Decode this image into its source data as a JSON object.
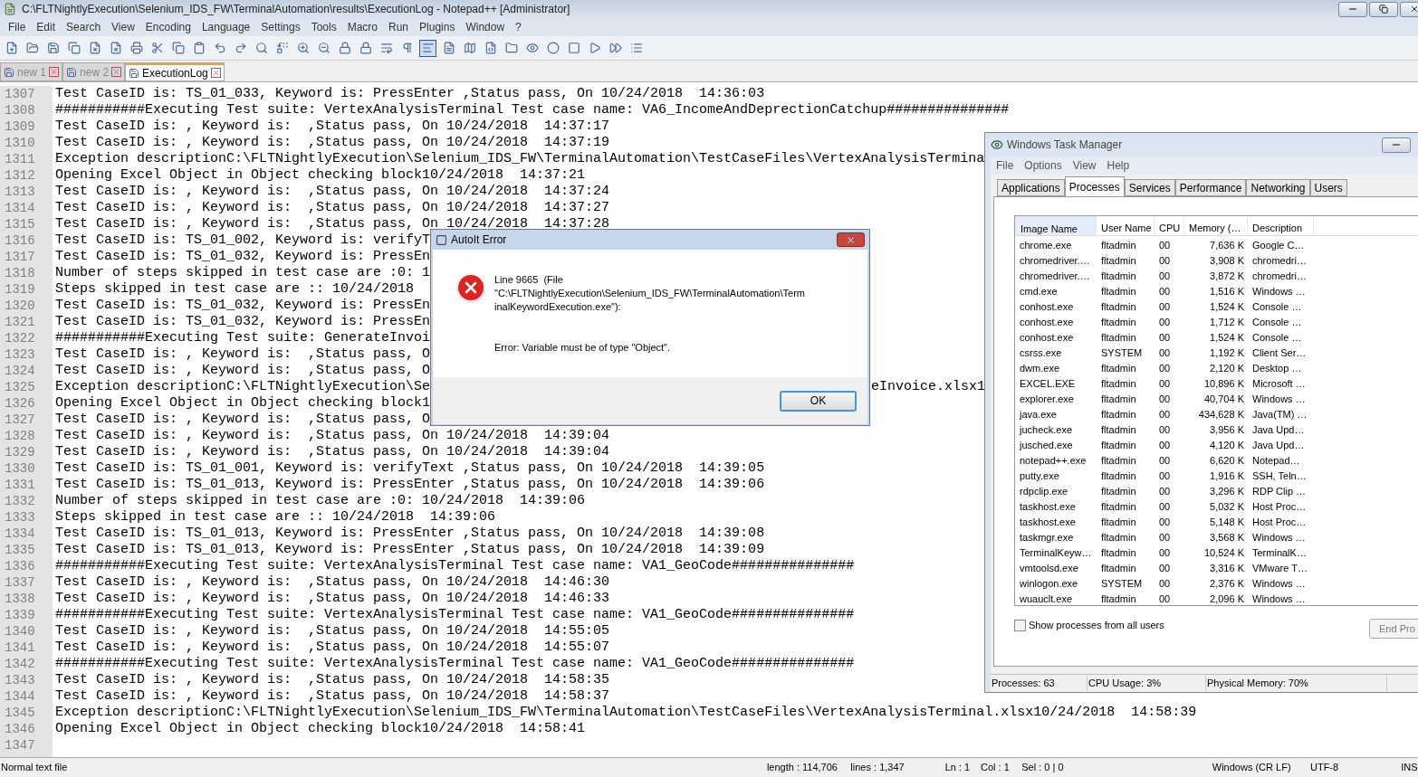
{
  "window": {
    "title": "C:\\FLTNightlyExecution\\Selenium_IDS_FW\\TerminalAutomation\\results\\ExecutionLog - Notepad++ [Administrator]"
  },
  "menu": [
    "File",
    "Edit",
    "Search",
    "View",
    "Encoding",
    "Language",
    "Settings",
    "Tools",
    "Macro",
    "Run",
    "Plugins",
    "Window",
    "?"
  ],
  "tabs": [
    {
      "label": "new 1",
      "selected": false
    },
    {
      "label": "new 2",
      "selected": false
    },
    {
      "label": "ExecutionLog",
      "selected": true
    }
  ],
  "editor": {
    "lines": [
      {
        "no": "1307",
        "text": "Test CaseID is: TS_01_033, Keyword is: PressEnter ,Status pass, On 10/24/2018  14:36:03"
      },
      {
        "no": "1308",
        "text": "###########Executing Test suite: VertexAnalysisTerminal Test case name: VA6_IncomeAndDeprectionCatchup###############"
      },
      {
        "no": "1309",
        "text": "Test CaseID is: , Keyword is:  ,Status pass, On 10/24/2018  14:37:17"
      },
      {
        "no": "1310",
        "text": "Test CaseID is: , Keyword is:  ,Status pass, On 10/24/2018  14:37:19"
      },
      {
        "no": "1311",
        "text": "Exception descriptionC:\\FLTNightlyExecution\\Selenium_IDS_FW\\TerminalAutomation\\TestCaseFiles\\VertexAnalysisTermina"
      },
      {
        "no": "1312",
        "text": "Opening Excel Object in Object checking block10/24/2018  14:37:21"
      },
      {
        "no": "1313",
        "text": "Test CaseID is: , Keyword is:  ,Status pass, On 10/24/2018  14:37:24"
      },
      {
        "no": "1314",
        "text": "Test CaseID is: , Keyword is:  ,Status pass, On 10/24/2018  14:37:27"
      },
      {
        "no": "1315",
        "text": "Test CaseID is: , Keyword is:  ,Status pass, On 10/24/2018  14:37:28"
      },
      {
        "no": "1316",
        "text": "Test CaseID is: TS_01_002, Keyword is: verifyT"
      },
      {
        "no": "1317",
        "text": "Test CaseID is: TS_01_032, Keyword is: PressEn"
      },
      {
        "no": "1318",
        "text": "Number of steps skipped in test case are :0: 1"
      },
      {
        "no": "1319",
        "text": "Steps skipped in test case are :: 10/24/2018"
      },
      {
        "no": "1320",
        "text": "Test CaseID is: TS_01_032, Keyword is: PressEn"
      },
      {
        "no": "1321",
        "text": "Test CaseID is: TS_01_032, Keyword is: PressEn"
      },
      {
        "no": "1322",
        "text": "###########Executing Test suite: GenerateInvoi"
      },
      {
        "no": "1323",
        "text": "Test CaseID is: , Keyword is:  ,Status pass, O"
      },
      {
        "no": "1324",
        "text": "Test CaseID is: , Keyword is:  ,Status pass, O"
      },
      {
        "no": "1325",
        "text": "Exception descriptionC:\\FLTNightlyExecution\\Se",
        "text_right": "eInvoice.xlsx1"
      },
      {
        "no": "1326",
        "text": "Opening Excel Object in Object checking block1"
      },
      {
        "no": "1327",
        "text": "Test CaseID is: , Keyword is:  ,Status pass, O"
      },
      {
        "no": "1328",
        "text": "Test CaseID is: , Keyword is:  ,Status pass, On 10/24/2018  14:39:04"
      },
      {
        "no": "1329",
        "text": "Test CaseID is: , Keyword is:  ,Status pass, On 10/24/2018  14:39:04"
      },
      {
        "no": "1330",
        "text": "Test CaseID is: TS_01_001, Keyword is: verifyText ,Status pass, On 10/24/2018  14:39:05"
      },
      {
        "no": "1331",
        "text": "Test CaseID is: TS_01_013, Keyword is: PressEnter ,Status pass, On 10/24/2018  14:39:06"
      },
      {
        "no": "1332",
        "text": "Number of steps skipped in test case are :0: 10/24/2018  14:39:06"
      },
      {
        "no": "1333",
        "text": "Steps skipped in test case are :: 10/24/2018  14:39:06"
      },
      {
        "no": "1334",
        "text": "Test CaseID is: TS_01_013, Keyword is: PressEnter ,Status pass, On 10/24/2018  14:39:08"
      },
      {
        "no": "1335",
        "text": "Test CaseID is: TS_01_013, Keyword is: PressEnter ,Status pass, On 10/24/2018  14:39:09"
      },
      {
        "no": "1336",
        "text": "###########Executing Test suite: VertexAnalysisTerminal Test case name: VA1_GeoCode###############"
      },
      {
        "no": "1337",
        "text": "Test CaseID is: , Keyword is:  ,Status pass, On 10/24/2018  14:46:30"
      },
      {
        "no": "1338",
        "text": "Test CaseID is: , Keyword is:  ,Status pass, On 10/24/2018  14:46:33"
      },
      {
        "no": "1339",
        "text": "###########Executing Test suite: VertexAnalysisTerminal Test case name: VA1_GeoCode###############"
      },
      {
        "no": "1340",
        "text": "Test CaseID is: , Keyword is:  ,Status pass, On 10/24/2018  14:55:05"
      },
      {
        "no": "1341",
        "text": "Test CaseID is: , Keyword is:  ,Status pass, On 10/24/2018  14:55:07"
      },
      {
        "no": "1342",
        "text": "###########Executing Test suite: VertexAnalysisTerminal Test case name: VA1_GeoCode###############"
      },
      {
        "no": "1343",
        "text": "Test CaseID is: , Keyword is:  ,Status pass, On 10/24/2018  14:58:35"
      },
      {
        "no": "1344",
        "text": "Test CaseID is: , Keyword is:  ,Status pass, On 10/24/2018  14:58:37"
      },
      {
        "no": "1345",
        "text": "Exception descriptionC:\\FLTNightlyExecution\\Selenium_IDS_FW\\TerminalAutomation\\TestCaseFiles\\VertexAnalysisTerminal.xlsx10/24/2018  14:58:39"
      },
      {
        "no": "1346",
        "text": "Opening Excel Object in Object checking block10/24/2018  14:58:41"
      },
      {
        "no": "1347"
      }
    ]
  },
  "status_bar": [
    "Normal text file",
    "length : 114,706",
    "lines : 1,347",
    "Ln : 1",
    "Col : 1",
    "Sel : 0 | 0",
    "Windows (CR LF)",
    "UTF-8",
    "INS"
  ],
  "task_manager": {
    "title": "Windows Task Manager",
    "menu": [
      "File",
      "Options",
      "View",
      "Help"
    ],
    "tabs": [
      {
        "label": "Applications",
        "selected": false
      },
      {
        "label": "Processes",
        "selected": true
      },
      {
        "label": "Services",
        "selected": false
      },
      {
        "label": "Performance",
        "selected": false
      },
      {
        "label": "Networking",
        "selected": false
      },
      {
        "label": "Users",
        "selected": false
      }
    ],
    "columns": [
      "Image Name",
      "User Name",
      "CPU",
      "Memory (…",
      "Description"
    ],
    "rows": [
      [
        "chrome.exe",
        "fltadmin",
        "00",
        "7,636 K",
        "Google C…"
      ],
      [
        "chromedriver.…",
        "fltadmin",
        "00",
        "3,908 K",
        "chromedri…"
      ],
      [
        "chromedriver.…",
        "fltadmin",
        "00",
        "3,872 K",
        "chromedri…"
      ],
      [
        "cmd.exe",
        "fltadmin",
        "00",
        "1,516 K",
        "Windows …"
      ],
      [
        "conhost.exe",
        "fltadmin",
        "00",
        "1,524 K",
        "Console …"
      ],
      [
        "conhost.exe",
        "fltadmin",
        "00",
        "1,712 K",
        "Console …"
      ],
      [
        "conhost.exe",
        "fltadmin",
        "00",
        "1,524 K",
        "Console …"
      ],
      [
        "csrss.exe",
        "SYSTEM",
        "00",
        "1,192 K",
        "Client Ser…"
      ],
      [
        "dwm.exe",
        "fltadmin",
        "00",
        "2,120 K",
        "Desktop …"
      ],
      [
        "EXCEL.EXE",
        "fltadmin",
        "00",
        "10,896 K",
        "Microsoft …"
      ],
      [
        "explorer.exe",
        "fltadmin",
        "00",
        "40,704 K",
        "Windows …"
      ],
      [
        "java.exe",
        "fltadmin",
        "00",
        "434,628 K",
        "Java(TM) …"
      ],
      [
        "jucheck.exe",
        "fltadmin",
        "00",
        "3,956 K",
        "Java Upd…"
      ],
      [
        "jusched.exe",
        "fltadmin",
        "00",
        "4,120 K",
        "Java Upd…"
      ],
      [
        "notepad++.exe",
        "fltadmin",
        "00",
        "6,620 K",
        "Notepad…"
      ],
      [
        "putty.exe",
        "fltadmin",
        "00",
        "1,916 K",
        "SSH, Teln…"
      ],
      [
        "rdpclip.exe",
        "fltadmin",
        "00",
        "3,296 K",
        "RDP Clip …"
      ],
      [
        "taskhost.exe",
        "fltadmin",
        "00",
        "5,032 K",
        "Host Proc…"
      ],
      [
        "taskhost.exe",
        "fltadmin",
        "00",
        "5,148 K",
        "Host Proc…"
      ],
      [
        "taskmgr.exe",
        "fltadmin",
        "00",
        "3,568 K",
        "Windows …"
      ],
      [
        "TerminalKeyw…",
        "fltadmin",
        "00",
        "10,524 K",
        "TerminalK…"
      ],
      [
        "vmtoolsd.exe",
        "fltadmin",
        "00",
        "3,316 K",
        "VMware T…"
      ],
      [
        "winlogon.exe",
        "SYSTEM",
        "00",
        "2,376 K",
        "Windows …"
      ],
      [
        "wuauclt.exe",
        "fltadmin",
        "00",
        "2,096 K",
        "Windows …"
      ]
    ],
    "show_all": {
      "label": "Show processes from all users",
      "checked": false
    },
    "end_button": "End Pro",
    "status": [
      "Processes: 63",
      "CPU Usage: 3%",
      "Physical Memory: 70%"
    ]
  },
  "dialog": {
    "title": "AutoIt Error",
    "message": [
      "Line 9665  (File",
      "\"C:\\FLTNightlyExecution\\Selenium_IDS_FW\\TerminalAutomation\\Term",
      "inalKeywordExecution.exe\"):"
    ],
    "error": "Error: Variable must be of type \"Object\".",
    "button": "OK"
  }
}
